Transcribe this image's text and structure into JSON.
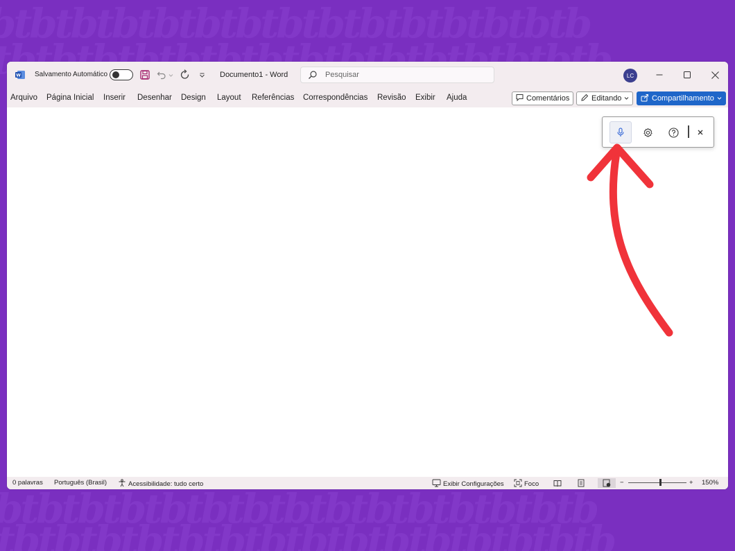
{
  "title_bar": {
    "app_icon": "word-icon",
    "autosave_label": "Salvamento Automático",
    "autosave_state": "off",
    "document_title": "Documento1",
    "separator": "-",
    "app_name": "Word",
    "search_placeholder": "Pesquisar",
    "avatar_initials": "LC"
  },
  "menu": {
    "items": [
      "Arquivo",
      "Página Inicial",
      "Inserir",
      "Desenhar",
      "Design",
      "Layout",
      "Referências",
      "Correspondências",
      "Revisão",
      "Exibir",
      "Ajuda"
    ],
    "comments_label": "Comentários",
    "editing_label": "Editando",
    "share_label": "Compartilhamento"
  },
  "dictation_toolbar": {
    "icons": [
      "microphone-icon",
      "settings-icon",
      "help-icon",
      "close-icon"
    ]
  },
  "status_bar": {
    "word_count": "0 palavras",
    "language": "Português (Brasil)",
    "accessibility": "Acessibilidade: tudo certo",
    "display_settings": "Exibir Configurações",
    "focus": "Foco",
    "zoom_minus": "−",
    "zoom_plus": "+",
    "zoom_level": "150%"
  },
  "colors": {
    "background": "#7a2fc0",
    "share_button": "#1f66c9",
    "annotation_arrow": "#f0333a",
    "avatar": "#3b3f8f"
  }
}
